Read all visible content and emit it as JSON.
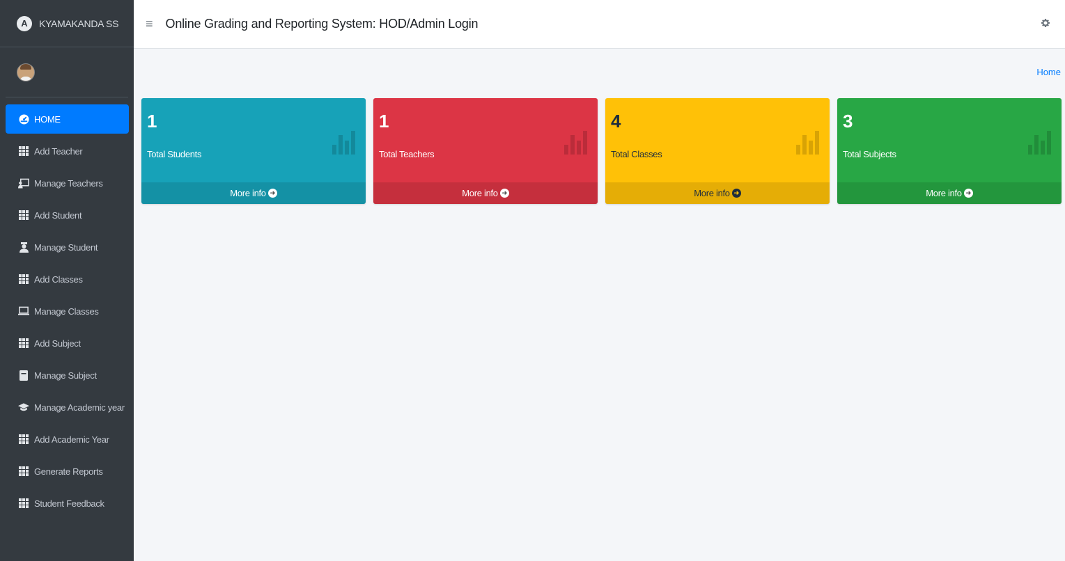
{
  "brand": {
    "name": "KYAMAKANDA SS",
    "logo_letter": "A"
  },
  "header": {
    "title": "Online Grading and Reporting System: HOD/Admin Login"
  },
  "breadcrumb": {
    "home": "Home"
  },
  "sidebar": {
    "items": [
      {
        "label": "HOME",
        "icon": "dashboard-icon",
        "active": true
      },
      {
        "label": "Add Teacher",
        "icon": "grid-icon"
      },
      {
        "label": "Manage Teachers",
        "icon": "chalkboard-teacher-icon"
      },
      {
        "label": "Add Student",
        "icon": "grid-icon"
      },
      {
        "label": "Manage Student",
        "icon": "user-graduate-icon"
      },
      {
        "label": "Add Classes",
        "icon": "grid-icon"
      },
      {
        "label": "Manage Classes",
        "icon": "laptop-icon"
      },
      {
        "label": "Add Subject",
        "icon": "grid-icon"
      },
      {
        "label": "Manage Subject",
        "icon": "book-icon"
      },
      {
        "label": "Manage Academic year",
        "icon": "graduation-cap-icon"
      },
      {
        "label": "Add Academic Year",
        "icon": "grid-icon"
      },
      {
        "label": "Generate Reports",
        "icon": "grid-icon"
      },
      {
        "label": "Student Feedback",
        "icon": "grid-icon"
      }
    ]
  },
  "cards": [
    {
      "value": "1",
      "label": "Total Students",
      "footer": "More info",
      "color": "#17a2b8"
    },
    {
      "value": "1",
      "label": "Total Teachers",
      "footer": "More info",
      "color": "#dc3545"
    },
    {
      "value": "4",
      "label": "Total Classes",
      "footer": "More info",
      "color": "#ffc107"
    },
    {
      "value": "3",
      "label": "Total Subjects",
      "footer": "More info",
      "color": "#28a745"
    }
  ]
}
